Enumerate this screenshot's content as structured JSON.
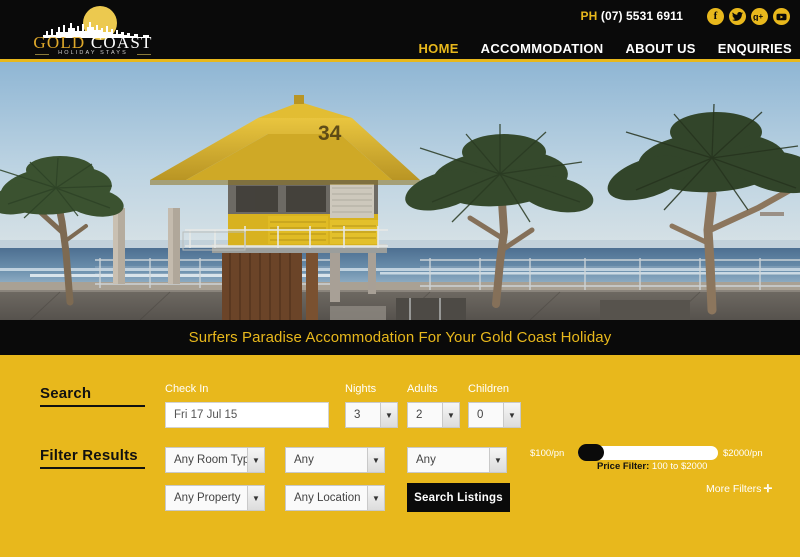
{
  "header": {
    "logo": {
      "word1": "GOLD",
      "word2": "COAST",
      "tagline": "HOLIDAY STAYS"
    },
    "phone_label": "PH",
    "phone_number": "(07) 5531 6911",
    "socials": [
      {
        "name": "facebook-icon",
        "glyph": "f"
      },
      {
        "name": "twitter-icon",
        "glyph": "t"
      },
      {
        "name": "googleplus-icon",
        "glyph": "g"
      },
      {
        "name": "youtube-icon",
        "glyph": "y"
      }
    ],
    "nav": [
      {
        "label": "HOME",
        "active": true
      },
      {
        "label": "ACCOMMODATION",
        "active": false
      },
      {
        "label": "ABOUT US",
        "active": false
      },
      {
        "label": "ENQUIRIES",
        "active": false
      }
    ]
  },
  "hero": {
    "alt": "Surfers Paradise beach boardwalk with lifeguard tower 34 and pandanus trees",
    "tower_number": "34"
  },
  "tagline": "Surfers Paradise Accommodation For Your Gold Coast Holiday",
  "search": {
    "heading": "Search",
    "checkin_label": "Check In",
    "checkin_value": "Fri 17 Jul 15",
    "nights_label": "Nights",
    "nights_value": "3",
    "adults_label": "Adults",
    "adults_value": "2",
    "children_label": "Children",
    "children_value": "0"
  },
  "filter": {
    "heading": "Filter Results",
    "room_type_value": "Any Room Type",
    "property_value": "Any Property",
    "any_value_1": "Any",
    "any_value_2": "Any",
    "location_value": "Any Location",
    "search_button": "Search Listings",
    "price_min": "$100/pn",
    "price_max": "$2000/pn",
    "price_caption_label": "Price Filter:",
    "price_caption_value": "100 to $2000",
    "more_filters": "More Filters",
    "more_filters_plus": "✛"
  },
  "colors": {
    "gold": "#e8b81c",
    "black": "#0a0a0a",
    "logo_gold": "#e0a92a",
    "white": "#ffffff"
  }
}
